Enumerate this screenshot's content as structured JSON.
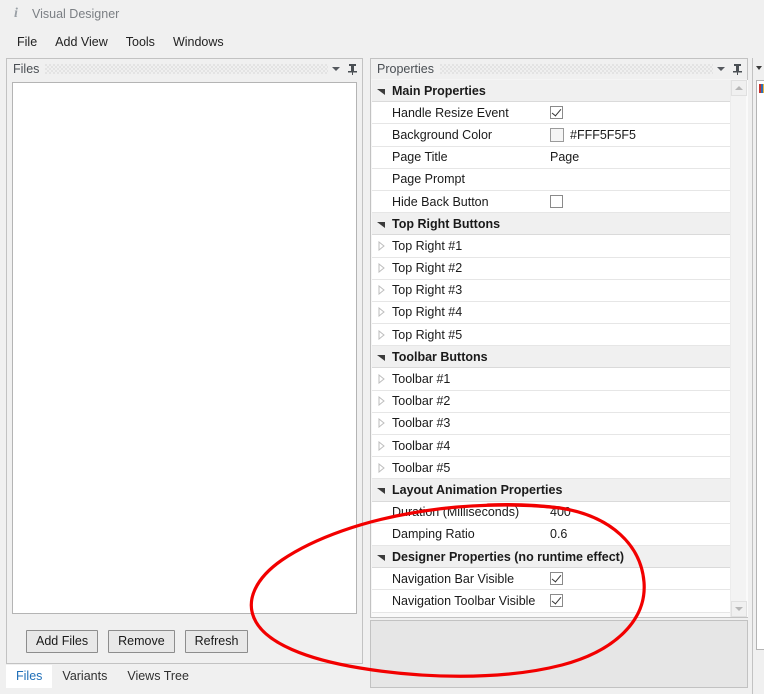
{
  "window": {
    "title": "Visual Designer",
    "icon": "info-icon"
  },
  "menubar": {
    "items": [
      {
        "label": "File"
      },
      {
        "label": "Add View"
      },
      {
        "label": "Tools"
      },
      {
        "label": "Windows"
      }
    ]
  },
  "files_panel": {
    "title": "Files",
    "dropdown_icon": "chevron-down-icon",
    "pin_icon": "pin-icon",
    "list_items": [],
    "buttons": [
      {
        "label": "Add Files"
      },
      {
        "label": "Remove"
      },
      {
        "label": "Refresh"
      }
    ]
  },
  "bottom_tabs": {
    "items": [
      {
        "label": "Files",
        "active": true
      },
      {
        "label": "Variants",
        "active": false
      },
      {
        "label": "Views Tree",
        "active": false
      }
    ]
  },
  "properties_panel": {
    "title": "Properties",
    "dropdown_icon": "chevron-down-icon",
    "pin_icon": "pin-icon",
    "scrollbar": {
      "up_icon": "scroll-up-arrow-icon",
      "down_icon": "scroll-down-arrow-icon"
    },
    "rows": [
      {
        "kind": "group",
        "expander": "expanded",
        "label": "Main Properties"
      },
      {
        "kind": "item",
        "expander": "none",
        "label": "Handle Resize Event",
        "value_type": "checkbox",
        "checked": true
      },
      {
        "kind": "item",
        "expander": "none",
        "label": "Background Color",
        "value_type": "color",
        "value": "#FFF5F5F5",
        "swatch": "#F5F5F5"
      },
      {
        "kind": "item",
        "expander": "none",
        "label": "Page Title",
        "value_type": "text",
        "value": "Page"
      },
      {
        "kind": "item",
        "expander": "none",
        "label": "Page Prompt",
        "value_type": "text",
        "value": ""
      },
      {
        "kind": "item",
        "expander": "none",
        "label": "Hide Back Button",
        "value_type": "checkbox",
        "checked": false
      },
      {
        "kind": "group",
        "expander": "expanded",
        "label": "Top Right Buttons"
      },
      {
        "kind": "item",
        "expander": "collapsed",
        "label": "Top Right #1",
        "value_type": "none"
      },
      {
        "kind": "item",
        "expander": "collapsed",
        "label": "Top Right #2",
        "value_type": "none"
      },
      {
        "kind": "item",
        "expander": "collapsed",
        "label": "Top Right #3",
        "value_type": "none"
      },
      {
        "kind": "item",
        "expander": "collapsed",
        "label": "Top Right #4",
        "value_type": "none"
      },
      {
        "kind": "item",
        "expander": "collapsed",
        "label": "Top Right #5",
        "value_type": "none"
      },
      {
        "kind": "group",
        "expander": "expanded",
        "label": "Toolbar Buttons"
      },
      {
        "kind": "item",
        "expander": "collapsed",
        "label": "Toolbar #1",
        "value_type": "none"
      },
      {
        "kind": "item",
        "expander": "collapsed",
        "label": "Toolbar #2",
        "value_type": "none"
      },
      {
        "kind": "item",
        "expander": "collapsed",
        "label": "Toolbar #3",
        "value_type": "none"
      },
      {
        "kind": "item",
        "expander": "collapsed",
        "label": "Toolbar #4",
        "value_type": "none"
      },
      {
        "kind": "item",
        "expander": "collapsed",
        "label": "Toolbar #5",
        "value_type": "none"
      },
      {
        "kind": "group",
        "expander": "expanded",
        "label": "Layout Animation Properties"
      },
      {
        "kind": "item",
        "expander": "none",
        "label": "Duration (Milliseconds)",
        "value_type": "text",
        "value": "400"
      },
      {
        "kind": "item",
        "expander": "none",
        "label": "Damping Ratio",
        "value_type": "text",
        "value": "0.6"
      },
      {
        "kind": "group",
        "expander": "expanded",
        "label": "Designer Properties (no runtime effect)"
      },
      {
        "kind": "item",
        "expander": "none",
        "label": "Navigation Bar Visible",
        "value_type": "checkbox",
        "checked": true
      },
      {
        "kind": "item",
        "expander": "none",
        "label": "Navigation Toolbar Visible",
        "value_type": "checkbox",
        "checked": true
      }
    ]
  },
  "annotation": {
    "shape": "hand-drawn-ellipse",
    "color": "#f20000"
  }
}
